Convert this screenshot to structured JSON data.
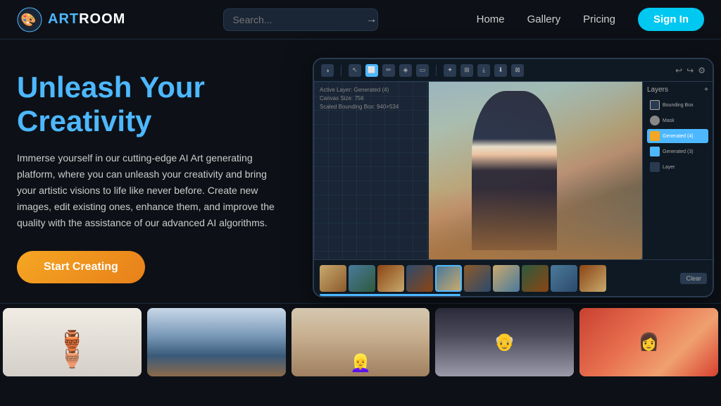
{
  "logo": {
    "text_art": "ART",
    "text_room": "ROOM"
  },
  "nav": {
    "search_placeholder": "Search...",
    "home_label": "Home",
    "gallery_label": "Gallery",
    "pricing_label": "Pricing",
    "signin_label": "Sign In"
  },
  "hero": {
    "title_line1": "Unleash Your",
    "title_line2": "Creativity",
    "description": "Immerse yourself in our cutting-edge AI Art generating platform, where you can unleash your creativity and bring your artistic visions to life like never before. Create new images, edit existing ones, enhance them, and improve the quality with the assistance of our advanced AI algorithms.",
    "cta_label": "Start Creating"
  },
  "editor": {
    "canvas_info_line1": "Active Layer: Generated (4)",
    "canvas_info_line2": "Canvas Size: 756",
    "canvas_info_line3": "Scaled Bounding Box: 940×534",
    "layers_title": "Layers",
    "layers_add": "+",
    "layer1": "Bounding Box",
    "layer2": "Mask",
    "layer3": "Generated (4)",
    "layer4": "Generated (3)",
    "layer5": "Layer",
    "filmstrip_clear": "Clear"
  },
  "toolbar": {
    "tools": [
      "◉",
      "✦",
      "✏",
      "⌗",
      "▭"
    ],
    "actions": [
      "✦",
      "⊞",
      "⤓",
      "⬇",
      "⊠"
    ],
    "undo": "↩",
    "redo": "↪"
  }
}
